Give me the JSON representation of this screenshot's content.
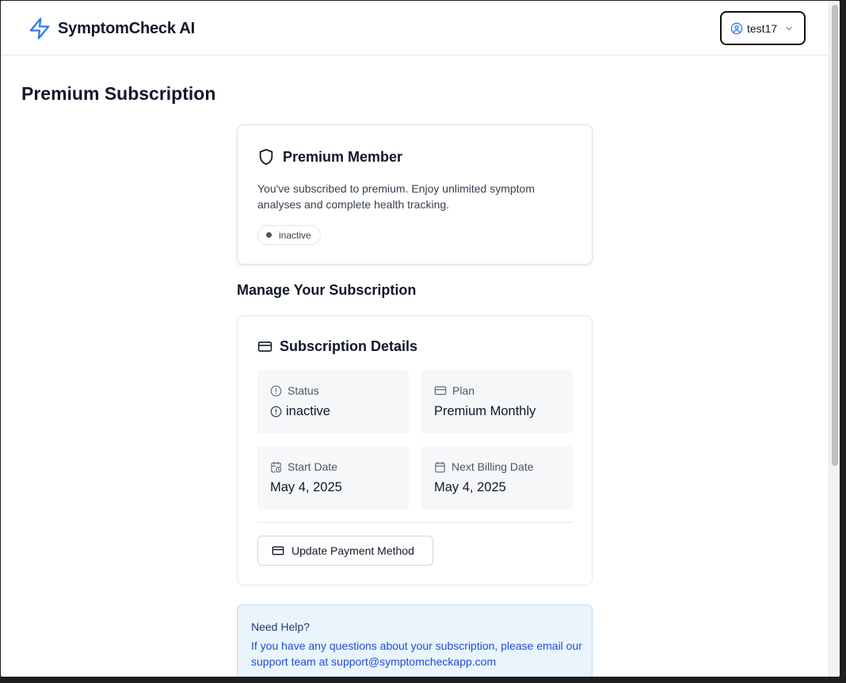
{
  "header": {
    "app_name": "SymptomCheck AI",
    "logo_icon": "lightning-bolt-icon",
    "brand_color": "#2b7de9",
    "user": {
      "name": "test17",
      "icon": "user-circle-icon",
      "dropdown_icon": "chevron-down-icon"
    }
  },
  "page": {
    "title": "Premium Subscription"
  },
  "member_card": {
    "icon": "shield-icon",
    "title": "Premium Member",
    "description": "You've subscribed to premium. Enjoy unlimited symptom analyses and complete health tracking.",
    "status_badge": "inactive"
  },
  "manage": {
    "section_title": "Manage Your Subscription",
    "details_card": {
      "icon": "credit-card-icon",
      "title": "Subscription Details",
      "tiles": [
        {
          "label": "Status",
          "value": "inactive",
          "icon": "alert-circle-icon"
        },
        {
          "label": "Plan",
          "value": "Premium Monthly",
          "icon": "credit-card-icon"
        },
        {
          "label": "Start Date",
          "value": "May 4, 2025",
          "icon": "calendar-clock-icon"
        },
        {
          "label": "Next Billing Date",
          "value": "May 4, 2025",
          "icon": "calendar-icon"
        }
      ],
      "update_button": "Update Payment Method"
    }
  },
  "help": {
    "title": "Need Help?",
    "text": "If you have any questions about your subscription, please email our support team at support@symptomcheckapp.com"
  }
}
